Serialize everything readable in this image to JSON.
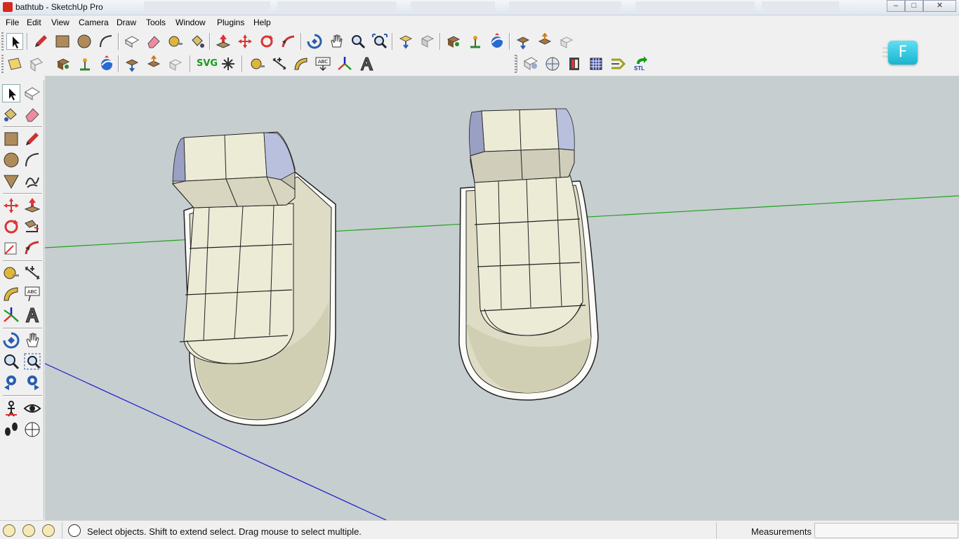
{
  "window": {
    "title": "bathtub - SketchUp Pro",
    "controls": {
      "minimize": "–",
      "maximize": "□",
      "close": "✕"
    }
  },
  "menu": [
    "File",
    "Edit",
    "View",
    "Camera",
    "Draw",
    "Tools",
    "Window",
    "Plugins",
    "Help"
  ],
  "toolbar": {
    "svg_label": "SVG",
    "stl_label": "STL",
    "abc_label": "ABC",
    "badge_letter": "F"
  },
  "status": {
    "hint": "Select objects. Shift to extend select. Drag mouse to select multiple.",
    "measurements_label": "Measurements",
    "measurements_value": ""
  },
  "colors": {
    "viewport_bg": "#c6ced0",
    "model_face": "#e8e6cc",
    "model_shadow": "#cfcdb0",
    "axis_green": "#1fa11f",
    "axis_blue": "#1a1acc",
    "badge": "#29c1dc"
  }
}
